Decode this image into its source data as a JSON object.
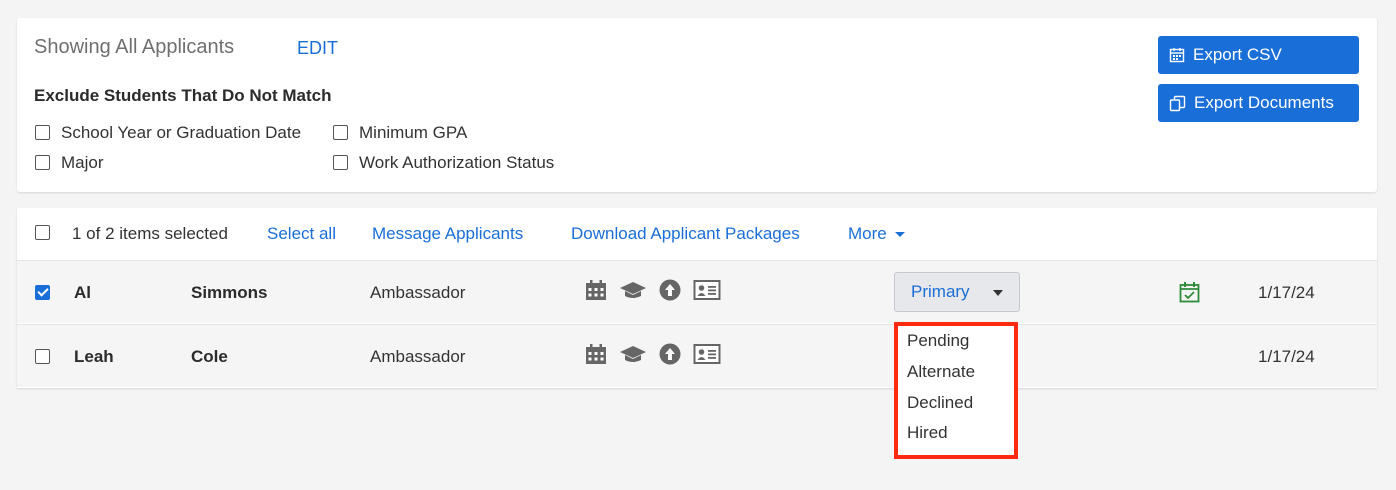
{
  "filters": {
    "showing_title": "Showing All Applicants",
    "edit_label": "EDIT",
    "exclude_heading": "Exclude Students That Do Not Match",
    "options": [
      {
        "label": "School Year or Graduation Date",
        "checked": false
      },
      {
        "label": "Minimum GPA",
        "checked": false
      },
      {
        "label": "Major",
        "checked": false
      },
      {
        "label": "Work Authorization Status",
        "checked": false
      }
    ]
  },
  "export": {
    "csv_label": "Export CSV",
    "csv_icon": "calendar-icon",
    "documents_label": "Export Documents",
    "documents_icon": "copy-documents-icon"
  },
  "toolbar": {
    "selected_text": "1 of 2 items selected",
    "select_all": "Select all",
    "message": "Message Applicants",
    "download": "Download Applicant Packages",
    "more": "More"
  },
  "rows": [
    {
      "checked": true,
      "first": "Al",
      "last": "Simmons",
      "role": "Ambassador",
      "status": "Primary",
      "date": "1/17/24",
      "calendar_check": true
    },
    {
      "checked": false,
      "first": "Leah",
      "last": "Cole",
      "role": "Ambassador",
      "status": "",
      "date": "1/17/24",
      "calendar_check": false
    }
  ],
  "status_dropdown": {
    "options": [
      "Pending",
      "Alternate",
      "Declined",
      "Hired"
    ]
  },
  "colors": {
    "accent": "#1a6ed8",
    "highlight_border": "#ff2a10",
    "check_green": "#2e8b3a"
  },
  "row_icons": [
    "calendar-icon",
    "graduation-cap-icon",
    "upload-arrow-icon",
    "id-card-icon"
  ]
}
